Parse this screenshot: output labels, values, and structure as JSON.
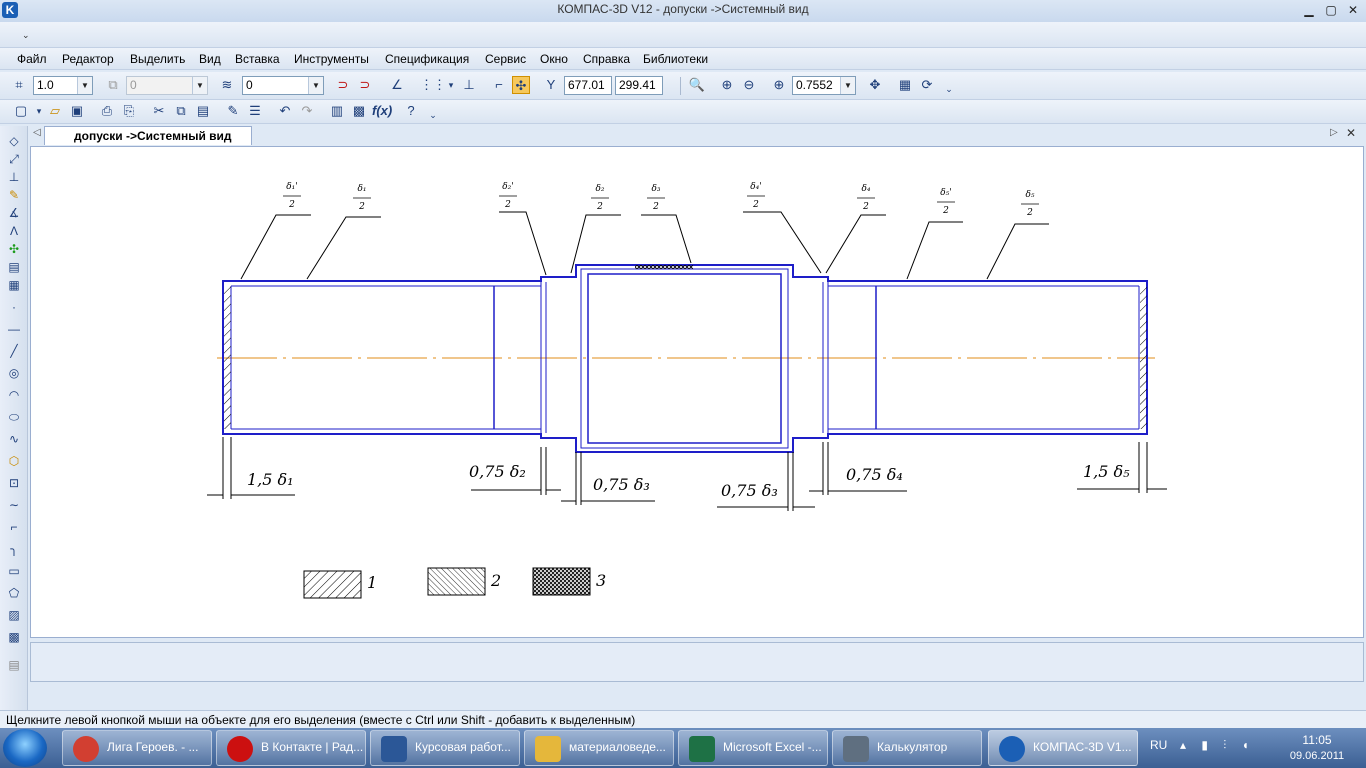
{
  "window": {
    "title": "КОМПАС-3D V12 - допуски ->Системный вид",
    "logo": "K"
  },
  "window_controls": {
    "minimize": "▁",
    "maximize": "▢",
    "close": "✕"
  },
  "menu": [
    {
      "label": "Файл"
    },
    {
      "label": "Редактор"
    },
    {
      "label": "Выделить"
    },
    {
      "label": "Вид"
    },
    {
      "label": "Вставка"
    },
    {
      "label": "Инструменты"
    },
    {
      "label": "Спецификация"
    },
    {
      "label": "Сервис"
    },
    {
      "label": "Окно"
    },
    {
      "label": "Справка"
    },
    {
      "label": "Библиотеки"
    }
  ],
  "toolbar": {
    "step": "1.0",
    "angle": "0",
    "layer": "0",
    "coord_x": "677.01",
    "coord_y": "299.41",
    "zoom": "0.7552"
  },
  "document_tab": {
    "label": "допуски ->Системный вид"
  },
  "drawing": {
    "tolerance_labels": [
      "δ₁'",
      "δ₁",
      "δ₂'",
      "δ₂",
      "δ₃",
      "δ₄'",
      "δ₄",
      "δ₅'",
      "δ₅"
    ],
    "dimension_labels": [
      "1,5 δ₁",
      "0,75 δ₂",
      "0,75 δ₃",
      "0,75 δ₃",
      "0,75 δ₄",
      "1,5 δ₅"
    ],
    "denominator": "2",
    "legend": [
      {
        "label": "1"
      },
      {
        "label": "2"
      },
      {
        "label": "3"
      }
    ],
    "line_color": "#1e1ec8",
    "axis_color": "#e08c1a"
  },
  "status_text": "Щелкните левой кнопкой мыши на объекте для его выделения (вместе с Ctrl или Shift - добавить к выделенным)",
  "taskbar": {
    "items": [
      {
        "label": "Лига Героев. - ...",
        "icon": "chrome-icon",
        "color": "#d23f31"
      },
      {
        "label": "В Контакте | Рад...",
        "icon": "opera-icon",
        "color": "#cc1010"
      },
      {
        "label": "Курсовая работ...",
        "icon": "word-icon",
        "color": "#2b5797"
      },
      {
        "label": "материаловеде...",
        "icon": "folder-icon",
        "color": "#e5b73b"
      },
      {
        "label": "Microsoft Excel -...",
        "icon": "excel-icon",
        "color": "#1e7145"
      },
      {
        "label": "Калькулятор",
        "icon": "calculator-icon",
        "color": "#5f6f80"
      },
      {
        "label": "КОМПАС-3D V1...",
        "icon": "kompas-icon",
        "color": "#1b5fb5"
      }
    ],
    "language": "RU",
    "time": "11:05",
    "date": "09.06.2011"
  }
}
